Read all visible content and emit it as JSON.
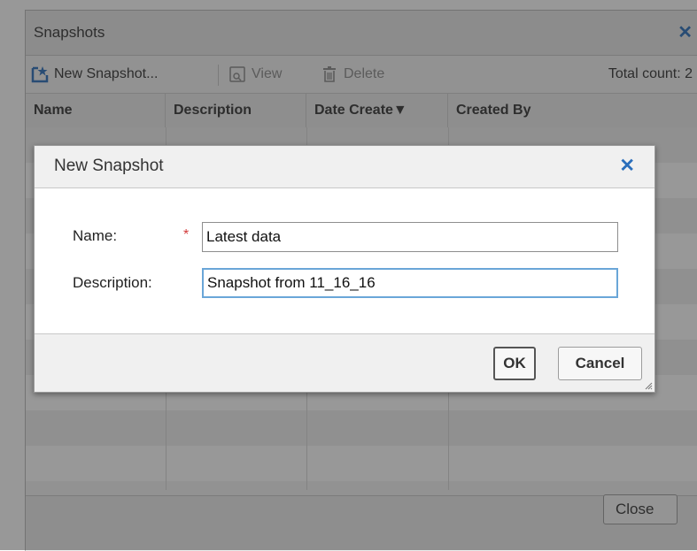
{
  "window": {
    "title": "Snapshots",
    "close_icon": "✕"
  },
  "toolbar": {
    "new_label": "New Snapshot...",
    "view_label": "View",
    "delete_label": "Delete",
    "total_count": "Total count: 2"
  },
  "table": {
    "columns": [
      "Name",
      "Description",
      "Date Create▼",
      "Created By"
    ]
  },
  "footer": {
    "close_label": "Close"
  },
  "dialog": {
    "title": "New Snapshot",
    "close_icon": "✕",
    "name_label": "Name:",
    "required_marker": "*",
    "name_value": "Latest data",
    "description_label": "Description:",
    "description_value": "Snapshot from 11_16_16",
    "ok_label": "OK",
    "cancel_label": "Cancel"
  },
  "colors": {
    "accent": "#2a6ebb",
    "required": "#d23a3a",
    "focus_border": "#6aa6d8"
  }
}
